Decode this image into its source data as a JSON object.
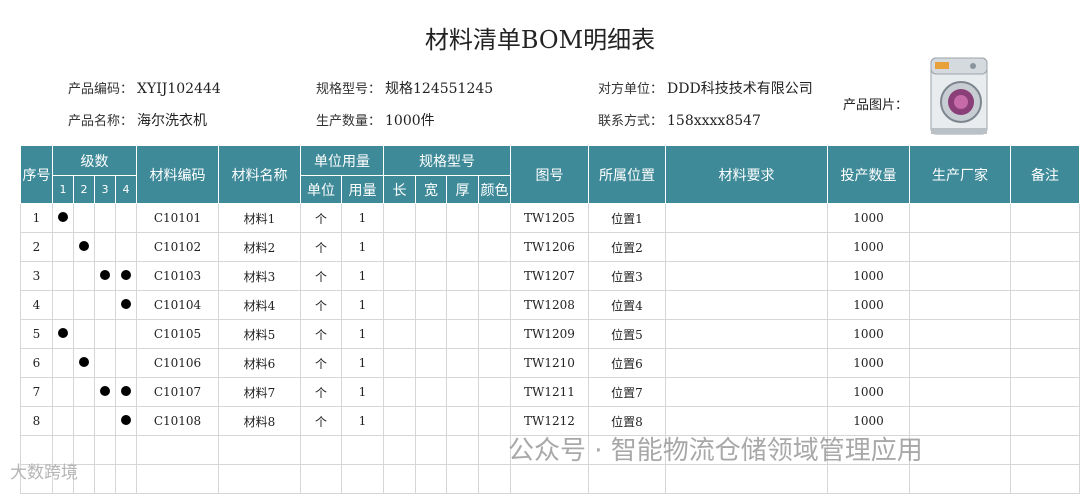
{
  "title": "材料清单BOM明细表",
  "info": {
    "product_code": {
      "label": "产品编码：",
      "value": "XYIJ102444"
    },
    "spec_model": {
      "label": "规格型号：",
      "value": "规格124551245"
    },
    "counterparty": {
      "label": "对方单位：",
      "value": "DDD科技技术有限公司"
    },
    "product_name": {
      "label": "产品名称：",
      "value": "海尔洗衣机"
    },
    "production_qty": {
      "label": "生产数量：",
      "value": "1000件"
    },
    "contact": {
      "label": "联系方式：",
      "value": "158xxxx8547"
    },
    "photo_label": "产品图片："
  },
  "headers": {
    "seq": "序号",
    "level": "级数",
    "level_cols": [
      "1",
      "2",
      "3",
      "4"
    ],
    "material_code": "材料编码",
    "material_name": "材料名称",
    "unit_usage": "单位用量",
    "unit": "单位",
    "usage": "用量",
    "spec": "规格型号",
    "length": "长",
    "width": "宽",
    "thickness": "厚",
    "color": "颜色",
    "drawing_no": "图号",
    "location": "所属位置",
    "requirement": "材料要求",
    "input_qty": "投产数量",
    "manufacturer": "生产厂家",
    "remarks": "备注"
  },
  "rows": [
    {
      "seq": "1",
      "levels": [
        1
      ],
      "code": "C10101",
      "name": "材料1",
      "unit": "个",
      "usage": "1",
      "drawing": "TW1205",
      "location": "位置1",
      "qty": "1000"
    },
    {
      "seq": "2",
      "levels": [
        2
      ],
      "code": "C10102",
      "name": "材料2",
      "unit": "个",
      "usage": "1",
      "drawing": "TW1206",
      "location": "位置2",
      "qty": "1000"
    },
    {
      "seq": "3",
      "levels": [
        3,
        4
      ],
      "code": "C10103",
      "name": "材料3",
      "unit": "个",
      "usage": "1",
      "drawing": "TW1207",
      "location": "位置3",
      "qty": "1000"
    },
    {
      "seq": "4",
      "levels": [
        4
      ],
      "code": "C10104",
      "name": "材料4",
      "unit": "个",
      "usage": "1",
      "drawing": "TW1208",
      "location": "位置4",
      "qty": "1000"
    },
    {
      "seq": "5",
      "levels": [
        1
      ],
      "code": "C10105",
      "name": "材料5",
      "unit": "个",
      "usage": "1",
      "drawing": "TW1209",
      "location": "位置5",
      "qty": "1000"
    },
    {
      "seq": "6",
      "levels": [
        2
      ],
      "code": "C10106",
      "name": "材料6",
      "unit": "个",
      "usage": "1",
      "drawing": "TW1210",
      "location": "位置6",
      "qty": "1000"
    },
    {
      "seq": "7",
      "levels": [
        3,
        4
      ],
      "code": "C10107",
      "name": "材料7",
      "unit": "个",
      "usage": "1",
      "drawing": "TW1211",
      "location": "位置7",
      "qty": "1000"
    },
    {
      "seq": "8",
      "levels": [
        4
      ],
      "code": "C10108",
      "name": "材料8",
      "unit": "个",
      "usage": "1",
      "drawing": "TW1212",
      "location": "位置8",
      "qty": "1000"
    }
  ],
  "watermark": "公众号 · 智能物流仓储领域管理应用",
  "watermark2": "大数跨境",
  "colors": {
    "header_bg": "#3e8a98",
    "header_text": "#ffffff",
    "grid": "#d6d6d6"
  }
}
